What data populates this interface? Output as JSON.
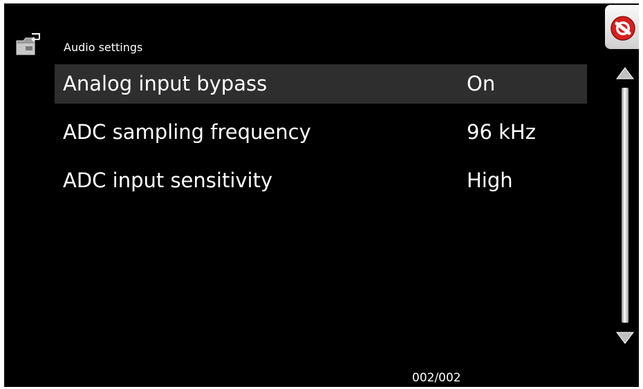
{
  "header": {
    "back_icon": "folder-back-icon",
    "title": "Audio settings"
  },
  "settings": {
    "items": [
      {
        "label": "Analog input bypass",
        "value": "On",
        "selected": true
      },
      {
        "label": "ADC sampling frequency",
        "value": "96 kHz",
        "selected": false
      },
      {
        "label": "ADC input sensitivity",
        "value": "High",
        "selected": false
      }
    ]
  },
  "controls": {
    "close_icon": "no-entry-icon",
    "scroll_up_icon": "triangle-up-icon",
    "scroll_down_icon": "triangle-down-icon",
    "scroll_position_fraction": 1.0
  },
  "footer": {
    "page_counter": "002/002"
  },
  "colors": {
    "background": "#000000",
    "selected_row": "#2e2e2e",
    "text": "#ffffff",
    "close_red": "#d42020"
  }
}
